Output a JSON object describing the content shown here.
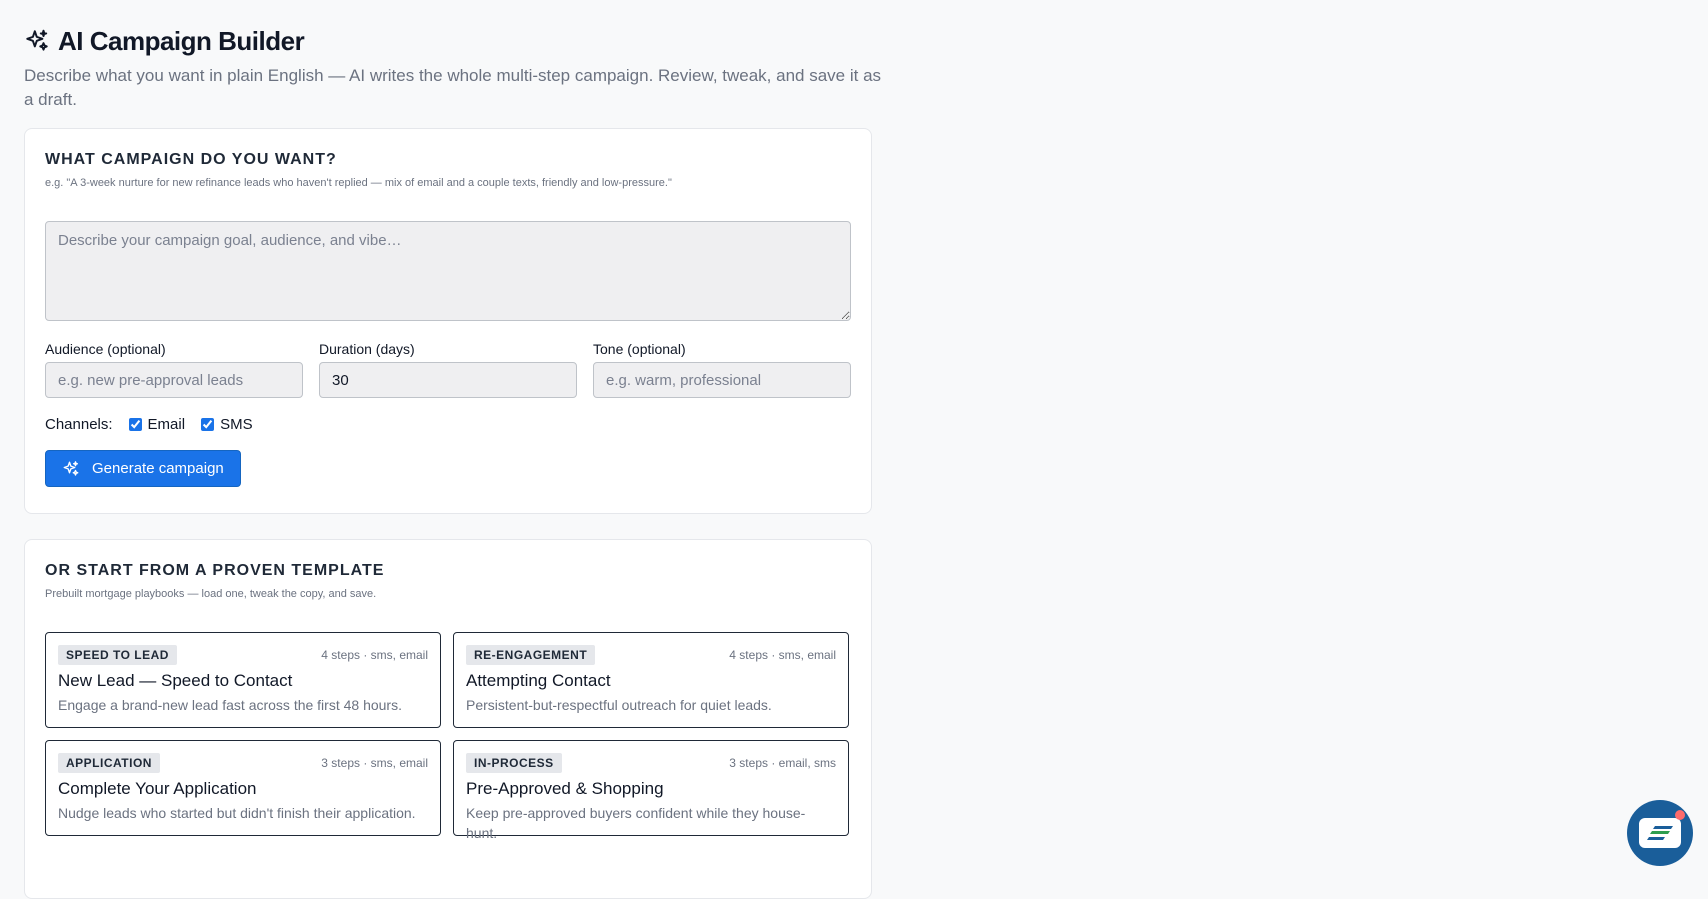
{
  "header": {
    "title": "AI Campaign Builder",
    "subtitle": "Describe what you want in plain English — AI writes the whole multi-step campaign. Review, tweak, and save it as a draft."
  },
  "builder": {
    "heading": "WHAT CAMPAIGN DO YOU WANT?",
    "hint": "e.g. \"A 3-week nurture for new refinance leads who haven't replied — mix of email and a couple texts, friendly and low-pressure.\"",
    "prompt_placeholder": "Describe your campaign goal, audience, and vibe…",
    "prompt_value": "",
    "audience": {
      "label": "Audience (optional)",
      "placeholder": "e.g. new pre-approval leads",
      "value": ""
    },
    "duration": {
      "label": "Duration (days)",
      "placeholder": "",
      "value": "30"
    },
    "tone": {
      "label": "Tone (optional)",
      "placeholder": "e.g. warm, professional",
      "value": ""
    },
    "channels_label": "Channels:",
    "channels": [
      {
        "label": "Email",
        "checked": true
      },
      {
        "label": "SMS",
        "checked": true
      }
    ],
    "generate_label": "Generate campaign"
  },
  "templates": {
    "heading": "OR START FROM A PROVEN TEMPLATE",
    "hint": "Prebuilt mortgage playbooks — load one, tweak the copy, and save.",
    "items": [
      {
        "badge": "SPEED TO LEAD",
        "meta": "4 steps · sms, email",
        "name": "New Lead — Speed to Contact",
        "desc": "Engage a brand-new lead fast across the first 48 hours."
      },
      {
        "badge": "RE-ENGAGEMENT",
        "meta": "4 steps · sms, email",
        "name": "Attempting Contact",
        "desc": "Persistent-but-respectful outreach for quiet leads."
      },
      {
        "badge": "APPLICATION",
        "meta": "3 steps · sms, email",
        "name": "Complete Your Application",
        "desc": "Nudge leads who started but didn't finish their application."
      },
      {
        "badge": "IN-PROCESS",
        "meta": "3 steps · email, sms",
        "name": "Pre-Approved & Shopping",
        "desc": "Keep pre-approved buyers confident while they house-hunt."
      }
    ]
  },
  "colors": {
    "primary": "#1a73e8",
    "fab": "#1a5e9a"
  },
  "icons": {
    "title": "sparkles-icon",
    "button": "sparkles-icon",
    "fab": "chat-logo-icon"
  }
}
